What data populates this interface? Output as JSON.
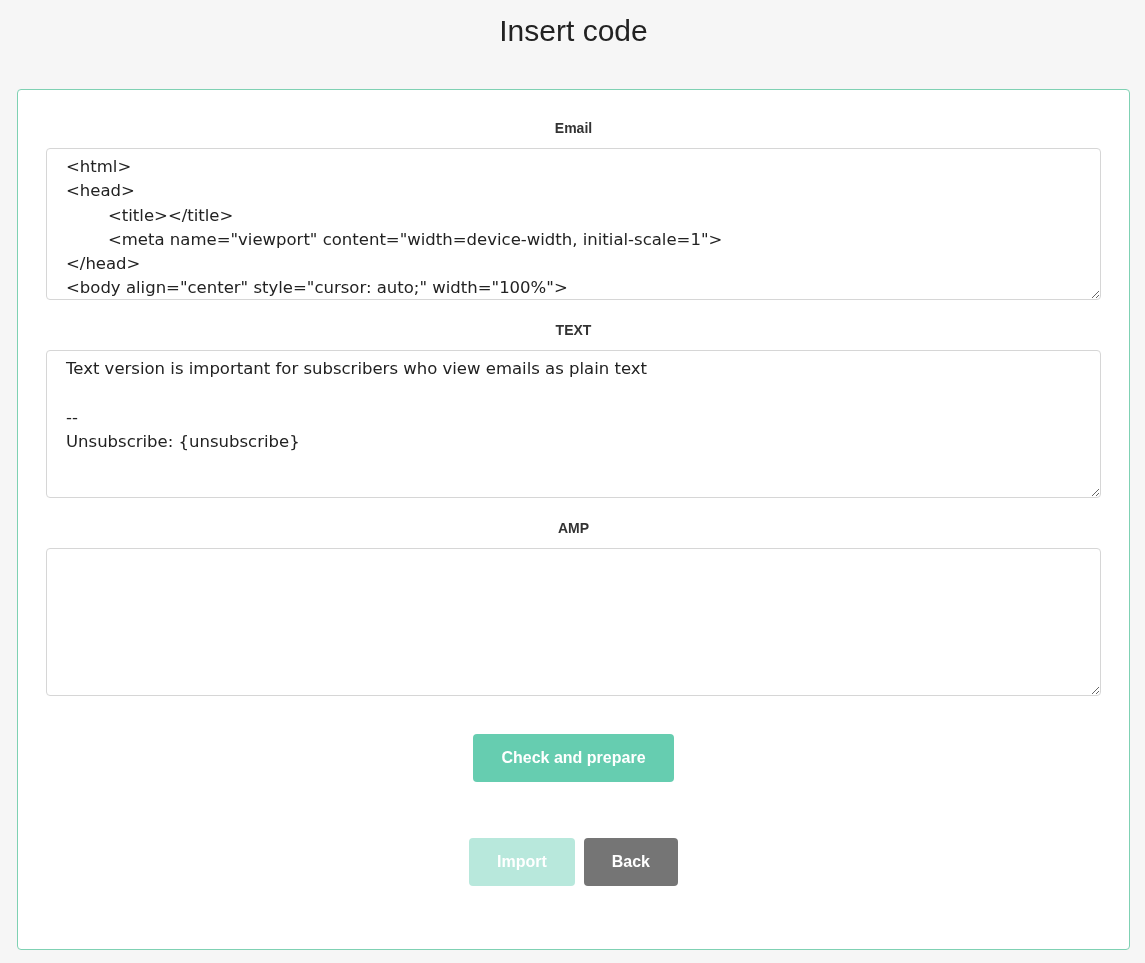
{
  "page": {
    "title": "Insert code"
  },
  "fields": [
    {
      "label": "Email",
      "value": "<html>\n<head>\n\t<title></title>\n\t<meta name=\"viewport\" content=\"width=device-width, initial-scale=1\">\n</head>\n<body align=\"center\" style=\"cursor: auto;\" width=\"100%\">"
    },
    {
      "label": "TEXT",
      "value": "Text version is important for subscribers who view emails as plain text\n\n--\nUnsubscribe: {unsubscribe}"
    },
    {
      "label": "AMP"
    }
  ],
  "check_button": {
    "label": "Check and prepare",
    "disabled": false
  },
  "footer_buttons": [
    {
      "label": "Import",
      "kind": "primary",
      "disabled": true
    },
    {
      "label": "Back",
      "kind": "secondary",
      "disabled": false
    }
  ]
}
